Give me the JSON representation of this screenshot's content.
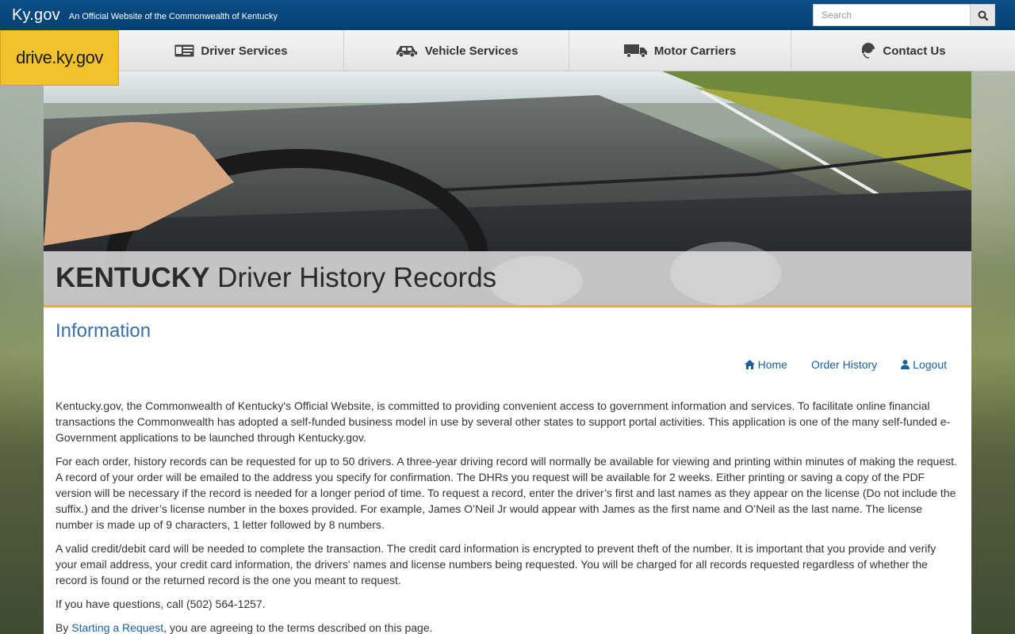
{
  "header": {
    "site_name": "Ky.gov",
    "tagline": "An Official Website of the Commonwealth of Kentucky",
    "search_placeholder": "Search"
  },
  "logo": {
    "text": "drive.ky.gov"
  },
  "nav": {
    "items": [
      {
        "label": "Driver Services",
        "icon": "license-card-icon"
      },
      {
        "label": "Vehicle Services",
        "icon": "car-icon"
      },
      {
        "label": "Motor Carriers",
        "icon": "truck-icon"
      },
      {
        "label": "Contact Us",
        "icon": "headset-icon"
      }
    ]
  },
  "hero": {
    "title_bold": "KENTUCKY",
    "title_rest": " Driver History Records"
  },
  "main": {
    "heading": "Information",
    "links": {
      "home": "Home",
      "order_history": "Order History",
      "logout": "Logout"
    },
    "paragraphs": [
      "Kentucky.gov, the Commonwealth of Kentucky's Official Website, is committed to providing convenient access to government information and services. To facilitate online financial transactions the Commonwealth has adopted a self-funded business model in use by several other states to support portal activities. This application is one of the many self-funded e-Government applications to be launched through Kentucky.gov.",
      "For each order, history records can be requested for up to 50 drivers. A three-year driving record will normally be available for viewing and printing within minutes of making the request. A record of your order will be emailed to the address you specify for confirmation. The DHRs you request will be available for 2 weeks. Either printing or saving a copy of the PDF version will be necessary if the record is needed for a longer period of time. To request a record, enter the driver’s first and last names as they appear on the license (Do not include the suffix.) and the driver’s license number in the boxes provided. For example, James O’Neil Jr would appear with James as the first name and O’Neil as the last name. The license number is made up of 9 characters, 1 letter followed by 8 numbers.",
      "A valid credit/debit card will be needed to complete the transaction. The credit card information is encrypted to prevent theft of the number. It is important that you provide and verify your email address, your credit card information, the drivers' names and license numbers being requested. You will be charged for all records requested regardless of whether the record is found or the returned record is the one you meant to request.",
      "If you have questions, call (502) 564-1257."
    ],
    "last_prefix": "By ",
    "last_link": "Starting a Request",
    "last_suffix": ", you are agreeing to the terms described on this page."
  },
  "colors": {
    "topbar": "#0a4f8a",
    "logo_bg": "#f2c12e",
    "link": "#1b5f9e",
    "heading": "#3b6ea5",
    "gold_rule": "#e0b42a"
  }
}
